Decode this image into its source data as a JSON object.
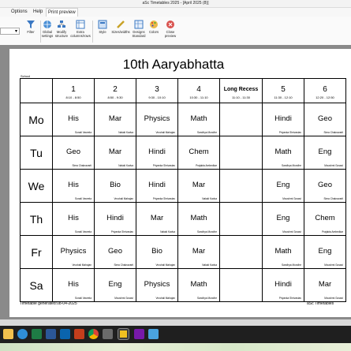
{
  "window": {
    "title": "aSc Timetables 2025 - [April 2025 (8)]"
  },
  "menu": {
    "items": [
      "Options",
      "Help",
      "Print preview"
    ],
    "active": "Print preview"
  },
  "ribbon": {
    "search_value": "▾",
    "buttons": [
      {
        "label": "Filter",
        "icon": "filter-icon"
      },
      {
        "label": "Global settings",
        "icon": "globe-settings-icon"
      },
      {
        "label": "Modify structure",
        "icon": "structure-icon"
      },
      {
        "label": "Extra columns/rows",
        "icon": "columns-icon"
      },
      {
        "label": "Style",
        "icon": "style-icon"
      },
      {
        "label": "Sizes/widths",
        "icon": "ruler-icon"
      },
      {
        "label": "Designs Standard",
        "icon": "design-icon"
      },
      {
        "label": "Colors",
        "icon": "palette-icon"
      },
      {
        "label": "Close preview",
        "icon": "close-preview-icon"
      }
    ]
  },
  "timetable": {
    "title": "10th Aaryabhatta",
    "school_label": "School",
    "periods": [
      {
        "num": "1",
        "time": "8:10 - 8:50"
      },
      {
        "num": "2",
        "time": "8:50 - 9:30"
      },
      {
        "num": "3",
        "time": "9:30 - 10:10"
      },
      {
        "num": "4",
        "time": "10:30 - 11:10"
      },
      {
        "recess": "Long Recess",
        "time": "11:10 - 11:30"
      },
      {
        "num": "5",
        "time": "11:30 - 12:10"
      },
      {
        "num": "6",
        "time": "12:20 - 12:50"
      }
    ],
    "days": [
      {
        "name": "Mo",
        "cells": [
          {
            "subject": "His",
            "teacher": "Sonali Vaveela"
          },
          {
            "subject": "Mar",
            "teacher": "Nalaki Kadva"
          },
          {
            "subject": "Physics",
            "teacher": "Vrushali Mahajan"
          },
          {
            "subject": "Math",
            "teacher": "Sandhya Mundhe"
          },
          {
            "subject": "",
            "teacher": ""
          },
          {
            "subject": "Hindi",
            "teacher": "Priyanka Shrivastav"
          },
          {
            "subject": "Geo",
            "teacher": "Sima Chakravarti"
          }
        ]
      },
      {
        "name": "Tu",
        "cells": [
          {
            "subject": "Geo",
            "teacher": "Sima Chakravarti"
          },
          {
            "subject": "Mar",
            "teacher": "Nalaki Kadva"
          },
          {
            "subject": "Hindi",
            "teacher": "Priyanka Shrivastav"
          },
          {
            "subject": "Chem",
            "teacher": "Prajakta Ambedkar"
          },
          {
            "subject": "",
            "teacher": ""
          },
          {
            "subject": "Math",
            "teacher": "Sandhya Mundhe"
          },
          {
            "subject": "Eng",
            "teacher": "Moushmi Gosavi"
          }
        ]
      },
      {
        "name": "We",
        "cells": [
          {
            "subject": "His",
            "teacher": "Sonali Vaveela"
          },
          {
            "subject": "Bio",
            "teacher": "Vrushali Mahajan"
          },
          {
            "subject": "Hindi",
            "teacher": "Priyanka Shrivastav"
          },
          {
            "subject": "Mar",
            "teacher": "Nalaki Kadva"
          },
          {
            "subject": "",
            "teacher": ""
          },
          {
            "subject": "Eng",
            "teacher": "Moushmi Gosavi"
          },
          {
            "subject": "Geo",
            "teacher": "Sima Chakravarti"
          }
        ]
      },
      {
        "name": "Th",
        "cells": [
          {
            "subject": "His",
            "teacher": "Sonali Vaveela"
          },
          {
            "subject": "Hindi",
            "teacher": "Priyanka Shrivastav"
          },
          {
            "subject": "Mar",
            "teacher": "Nalaki Kadva"
          },
          {
            "subject": "Math",
            "teacher": "Sandhya Mundhe"
          },
          {
            "subject": "",
            "teacher": ""
          },
          {
            "subject": "Eng",
            "teacher": "Moushmi Gosavi"
          },
          {
            "subject": "Chem",
            "teacher": "Prajakta Ambedkar"
          }
        ]
      },
      {
        "name": "Fr",
        "cells": [
          {
            "subject": "Physics",
            "teacher": "Vrushali Mahajan"
          },
          {
            "subject": "Geo",
            "teacher": "Sima Chakravarti"
          },
          {
            "subject": "Bio",
            "teacher": "Vrushali Mahajan"
          },
          {
            "subject": "Mar",
            "teacher": "Nalaki Kadva"
          },
          {
            "subject": "",
            "teacher": ""
          },
          {
            "subject": "Math",
            "teacher": "Sandhya Mundhe"
          },
          {
            "subject": "Eng",
            "teacher": "Moushmi Gosavi"
          }
        ]
      },
      {
        "name": "Sa",
        "cells": [
          {
            "subject": "His",
            "teacher": "Sonali Vaveela"
          },
          {
            "subject": "Eng",
            "teacher": "Moushmi Gosavi"
          },
          {
            "subject": "Physics",
            "teacher": "Vrushali Mahajan"
          },
          {
            "subject": "Math",
            "teacher": "Sandhya Mundhe"
          },
          {
            "subject": "",
            "teacher": ""
          },
          {
            "subject": "Hindi",
            "teacher": "Priyanka Shrivastav"
          },
          {
            "subject": "Mar",
            "teacher": "Moushmi Gosavi"
          }
        ]
      }
    ],
    "footer_left": "Timetable generated:08-04-2025",
    "footer_right": "aSc Timetables"
  },
  "taskbar": {
    "icons": [
      "file-explorer-icon",
      "edge-icon",
      "excel-icon",
      "word-icon",
      "outlook-icon",
      "powerpoint-icon",
      "chrome-icon",
      "settings-icon",
      "asc-timetables-icon",
      "onenote-icon",
      "notepad-icon"
    ],
    "active_icon": "asc-timetables-icon"
  },
  "colors": {
    "accent": "#2b5797",
    "ribbon_bg": "#fafafa",
    "preview_bg": "#8a8a8a",
    "taskbar": "#1f1f1f"
  }
}
